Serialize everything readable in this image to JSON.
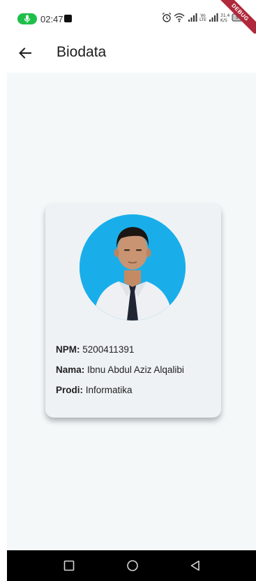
{
  "status_bar": {
    "time": "02:47",
    "net_type": "Vo LTE",
    "net_speed_value": "31.4",
    "net_speed_unit": "K/S",
    "battery_level": "58"
  },
  "debug_banner": "DEBUG",
  "app_bar": {
    "title": "Biodata"
  },
  "profile": {
    "npm_label": "NPM:",
    "npm_value": "5200411391",
    "nama_label": "Nama:",
    "nama_value": "Ibnu Abdul Aziz Alqalibi",
    "prodi_label": "Prodi:",
    "prodi_value": "Informatika"
  },
  "colors": {
    "avatar_background": "#19aeea",
    "page_background": "#f4f8f9",
    "card_background": "#eef2f4",
    "mic_indicator": "#1fbf4a",
    "debug_ribbon": "#b0283b"
  },
  "icons": {
    "back": "arrow-left-icon",
    "recents": "square-recents-icon",
    "home": "circle-home-icon",
    "navigate_back": "triangle-back-icon"
  }
}
